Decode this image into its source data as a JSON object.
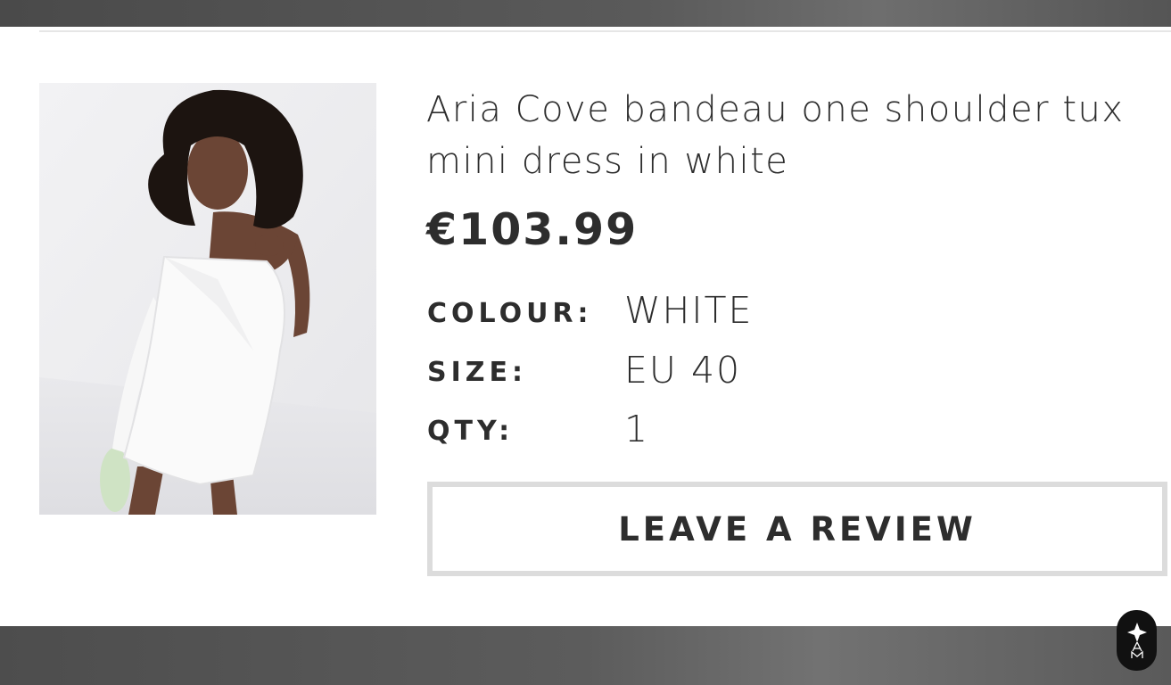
{
  "product": {
    "title": "Aria Cove bandeau one shoulder tux mini dress in white",
    "price": "€103.99",
    "image": {
      "alt_semantic": "product-photo"
    }
  },
  "attributes": {
    "colour_label": "COLOUR:",
    "colour_value": "WHITE",
    "size_label": "SIZE:",
    "size_value": "EU 40",
    "qty_label": "QTY:",
    "qty_value": "1"
  },
  "actions": {
    "review_label": "LEAVE A REVIEW"
  },
  "badge": {
    "icon": "brand-logo-icon"
  },
  "colors": {
    "text": "#2d2d2d",
    "button_border": "#dcdcdc",
    "top_bar": "#555555",
    "bottom_bar": "#5c5c5c",
    "badge_bg": "#111111"
  }
}
